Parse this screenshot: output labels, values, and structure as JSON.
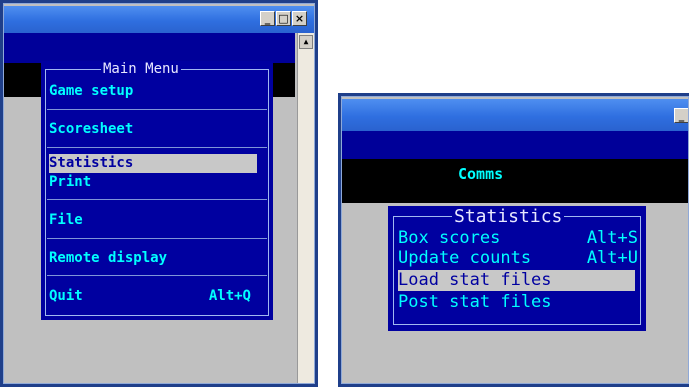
{
  "left_window": {
    "buttons": {
      "minimize": "_",
      "maximize": "□",
      "close": "×"
    },
    "menu": {
      "title": "Main Menu",
      "items": [
        {
          "label": "Game setup",
          "shortcut": ""
        },
        {
          "label": "Scoresheet",
          "shortcut": ""
        },
        {
          "label": "Statistics",
          "shortcut": "",
          "selected": true
        },
        {
          "label": "Print",
          "shortcut": ""
        },
        {
          "label": "File",
          "shortcut": ""
        },
        {
          "label": "Remote display",
          "shortcut": ""
        },
        {
          "label": "Quit",
          "shortcut": "Alt+Q"
        }
      ]
    }
  },
  "right_window": {
    "buttons": {
      "minimize": "_"
    },
    "header_text": "Comms",
    "menu": {
      "title": "Statistics",
      "items": [
        {
          "label": "Box scores",
          "shortcut": "Alt+S"
        },
        {
          "label": "Update counts",
          "shortcut": "Alt+U"
        },
        {
          "label": "Load stat files",
          "shortcut": "",
          "selected": true
        },
        {
          "label": "Post stat files",
          "shortcut": ""
        }
      ]
    }
  },
  "colors": {
    "menu_bg": "#0000a0",
    "menu_text": "#00ffff",
    "selection_bg": "#c8c8c8",
    "titlebar": "#2f6fe0"
  }
}
